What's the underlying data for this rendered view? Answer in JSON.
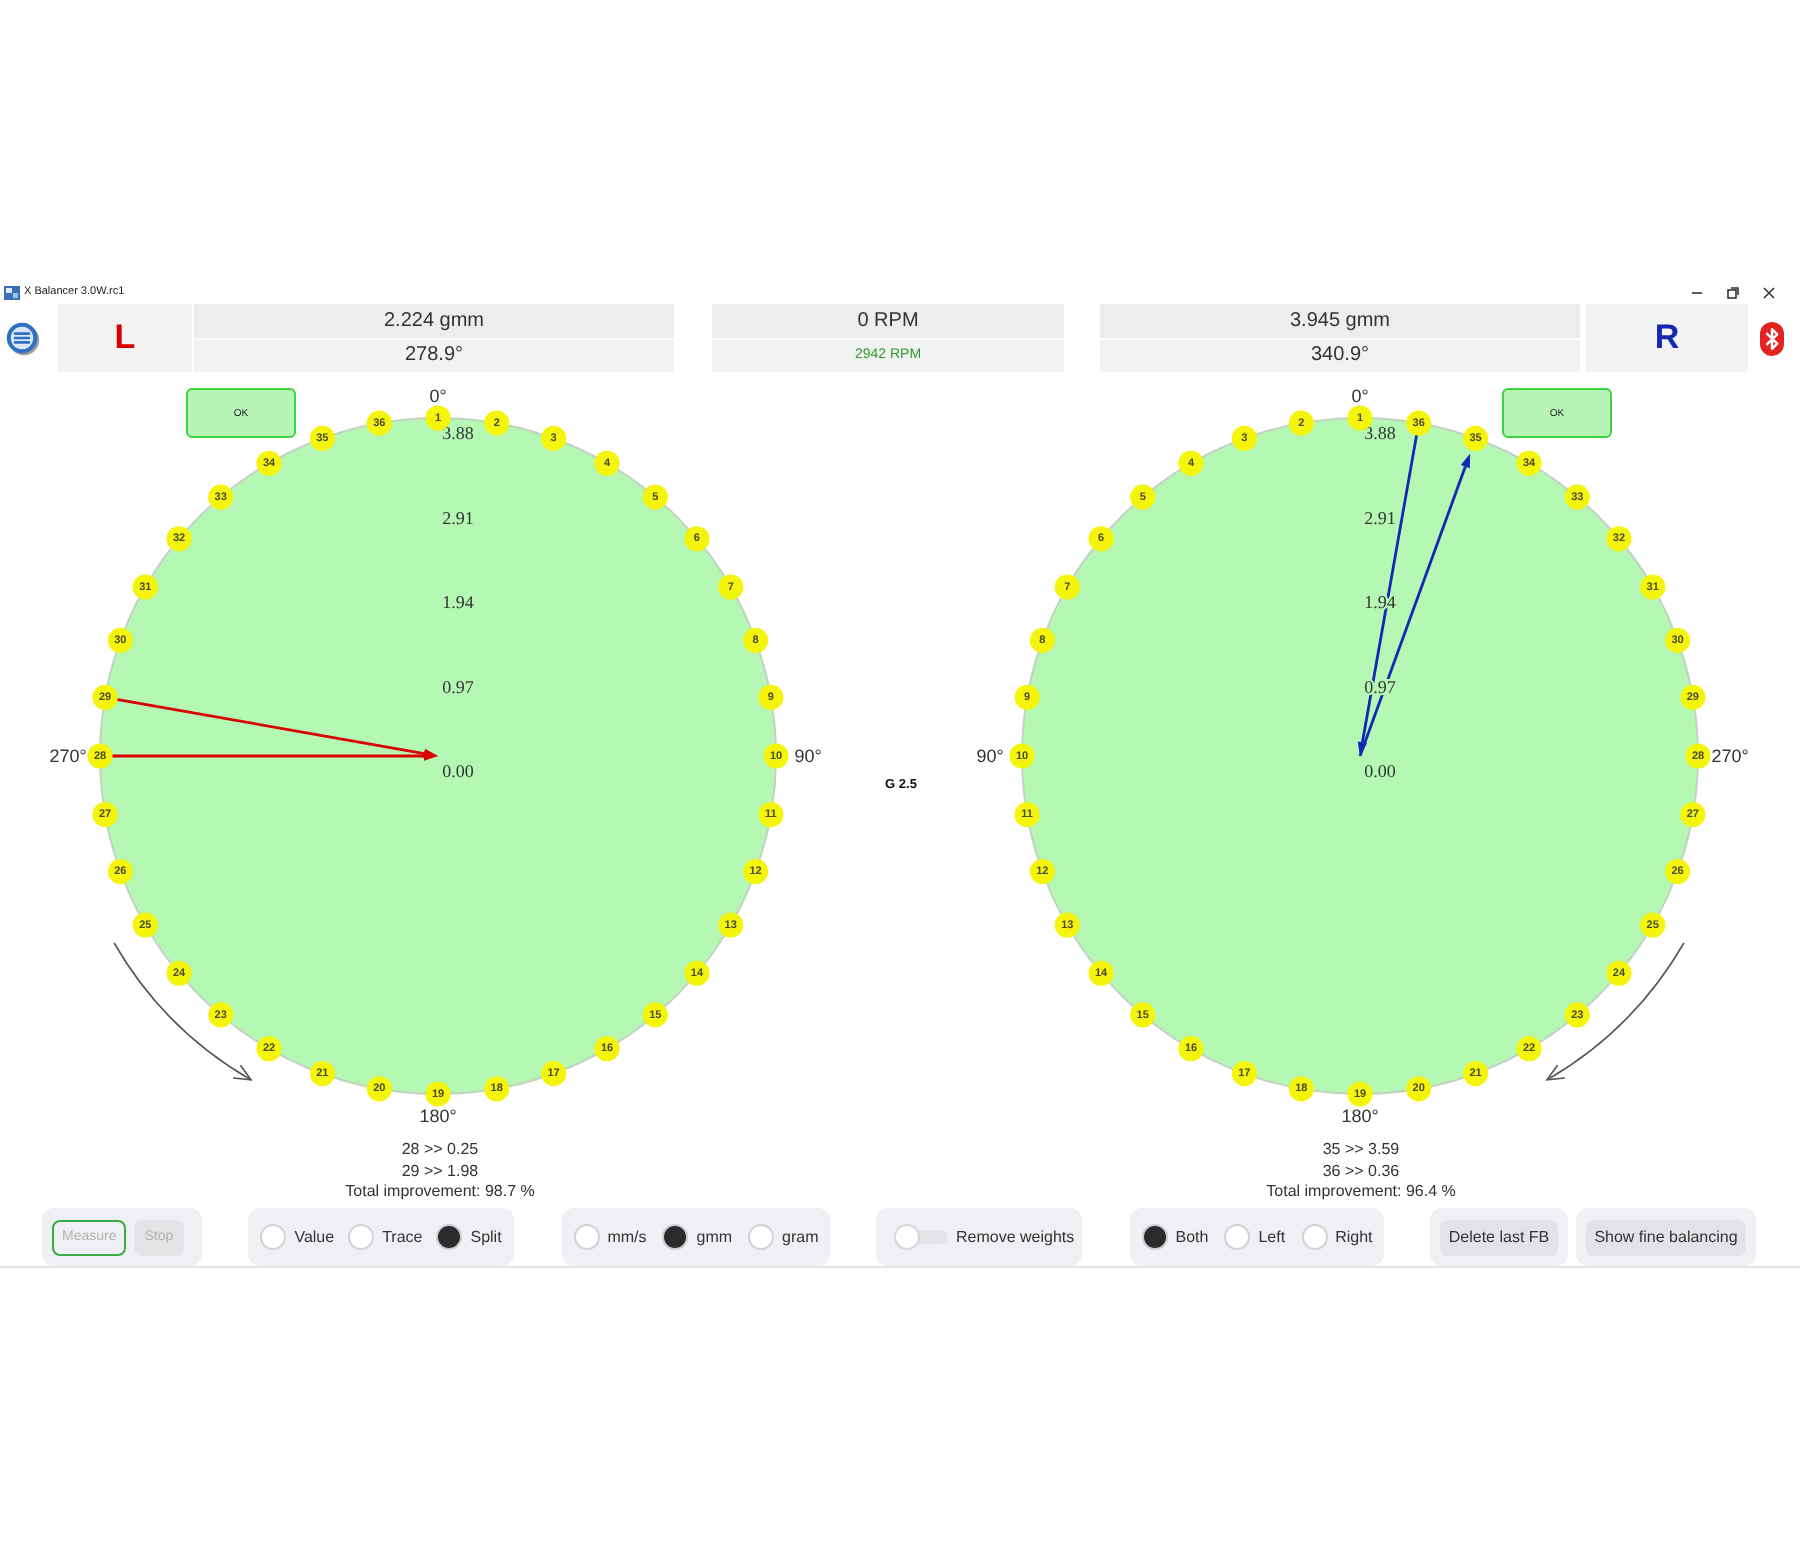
{
  "window": {
    "title": "X Balancer 3.0W.rc1"
  },
  "speed": {
    "current": "0 RPM",
    "measured": "2942 RPM"
  },
  "planes": [
    {
      "side": "L",
      "color": "#d80000",
      "amount": "2.224 gmm",
      "angle": "278.9°",
      "ok_button": "OK",
      "clockwise": true,
      "angle_labels": [
        "0°",
        "90°",
        "180°",
        "270°"
      ],
      "scale_labels": [
        "3.88",
        "2.91",
        "1.94",
        "0.97",
        "0.00"
      ],
      "positions": {
        "first_arc": [
          {
            "label": "1",
            "kind": "plain"
          },
          {
            "label": "2",
            "kind": "plain"
          },
          {
            "label": "3",
            "kind": "plain"
          },
          {
            "label": "4",
            "kind": "plain"
          },
          {
            "label": "5",
            "kind": "plain"
          },
          {
            "label": "6",
            "kind": "plain"
          },
          {
            "label": "7",
            "kind": "plain"
          },
          {
            "label": "8",
            "kind": "plain"
          },
          {
            "label": "9",
            "kind": "plain"
          },
          {
            "label": "10",
            "kind": "plain"
          },
          {
            "label": "11",
            "kind": "plain"
          },
          {
            "label": "12",
            "kind": "plain"
          },
          {
            "label": "13",
            "kind": "plain"
          },
          {
            "label": "14",
            "kind": "plain"
          },
          {
            "label": "15",
            "kind": "plain"
          },
          {
            "label": "16",
            "kind": "plain"
          },
          {
            "label": "17",
            "kind": "plain"
          },
          {
            "label": "18",
            "kind": "plain"
          },
          {
            "label": "19",
            "kind": "plain"
          }
        ],
        "second_arc": [
          {
            "label": "36",
            "kind": "plain"
          },
          {
            "label": "35",
            "kind": "plain"
          },
          {
            "label": "34",
            "kind": "plain"
          },
          {
            "label": "33",
            "kind": "plain"
          },
          {
            "label": "32",
            "kind": "plain"
          },
          {
            "label": "31",
            "kind": "plain"
          },
          {
            "label": "30",
            "kind": "plain"
          },
          {
            "label": "29",
            "kind": "inward"
          },
          {
            "label": "28",
            "kind": "inward"
          },
          {
            "label": "27",
            "kind": "plain"
          },
          {
            "label": "26",
            "kind": "plain"
          },
          {
            "label": "25",
            "kind": "plain"
          },
          {
            "label": "24",
            "kind": "plain"
          },
          {
            "label": "23",
            "kind": "plain"
          },
          {
            "label": "22",
            "kind": "plain"
          },
          {
            "label": "21",
            "kind": "plain"
          },
          {
            "label": "20",
            "kind": "plain"
          }
        ]
      },
      "results": [
        "28 >> 0.25",
        "29 >> 1.98"
      ],
      "total": "Total improvement: 98.7 %"
    },
    {
      "side": "R",
      "color": "#1428b4",
      "amount": "3.945 gmm",
      "angle": "340.9°",
      "ok_button": "OK",
      "clockwise": false,
      "angle_labels": [
        "0°",
        "90°",
        "180°",
        "270°"
      ],
      "scale_labels": [
        "3.88",
        "2.91",
        "1.94",
        "0.97",
        "0.00"
      ],
      "positions": {
        "first_arc": [
          {
            "label": "1",
            "kind": "plain"
          },
          {
            "label": "2",
            "kind": "plain"
          },
          {
            "label": "3",
            "kind": "plain"
          },
          {
            "label": "4",
            "kind": "plain"
          },
          {
            "label": "5",
            "kind": "plain"
          },
          {
            "label": "6",
            "kind": "plain"
          },
          {
            "label": "7",
            "kind": "plain"
          },
          {
            "label": "8",
            "kind": "plain"
          },
          {
            "label": "9",
            "kind": "plain"
          },
          {
            "label": "10",
            "kind": "plain"
          },
          {
            "label": "11",
            "kind": "plain"
          },
          {
            "label": "12",
            "kind": "plain"
          },
          {
            "label": "13",
            "kind": "plain"
          },
          {
            "label": "14",
            "kind": "plain"
          },
          {
            "label": "15",
            "kind": "plain"
          },
          {
            "label": "16",
            "kind": "plain"
          },
          {
            "label": "17",
            "kind": "plain"
          },
          {
            "label": "18",
            "kind": "plain"
          },
          {
            "label": "19",
            "kind": "plain"
          }
        ],
        "second_arc": [
          {
            "label": "36",
            "kind": "inward"
          },
          {
            "label": "35",
            "kind": "outward"
          },
          {
            "label": "34",
            "kind": "plain"
          },
          {
            "label": "33",
            "kind": "plain"
          },
          {
            "label": "32",
            "kind": "plain"
          },
          {
            "label": "31",
            "kind": "plain"
          },
          {
            "label": "30",
            "kind": "plain"
          },
          {
            "label": "29",
            "kind": "plain"
          },
          {
            "label": "28",
            "kind": "plain"
          },
          {
            "label": "27",
            "kind": "plain"
          },
          {
            "label": "26",
            "kind": "plain"
          },
          {
            "label": "25",
            "kind": "plain"
          },
          {
            "label": "24",
            "kind": "plain"
          },
          {
            "label": "23",
            "kind": "plain"
          },
          {
            "label": "22",
            "kind": "plain"
          },
          {
            "label": "21",
            "kind": "plain"
          },
          {
            "label": "20",
            "kind": "plain"
          }
        ]
      },
      "results": [
        "35 >> 3.59",
        "36 >> 0.36"
      ],
      "total": "Total improvement: 96.4 %"
    }
  ],
  "grade": "G 2.5",
  "controls": {
    "run_buttons": [
      {
        "label": "Measure",
        "disabled": true,
        "focused": true
      },
      {
        "label": "Stop",
        "disabled": true,
        "focused": false
      }
    ],
    "display_mode": [
      {
        "label": "Value",
        "selected": false
      },
      {
        "label": "Trace",
        "selected": false
      },
      {
        "label": "Split",
        "selected": true
      }
    ],
    "units": [
      {
        "label": "mm/s",
        "selected": false
      },
      {
        "label": "gmm",
        "selected": true
      },
      {
        "label": "gram",
        "selected": false
      }
    ],
    "remove_weights": {
      "label": "Remove weights",
      "on": false
    },
    "sides": [
      {
        "label": "Both",
        "selected": true
      },
      {
        "label": "Left",
        "selected": false
      },
      {
        "label": "Right",
        "selected": false
      }
    ],
    "actions": [
      "Delete last FB",
      "Show fine balancing"
    ]
  }
}
